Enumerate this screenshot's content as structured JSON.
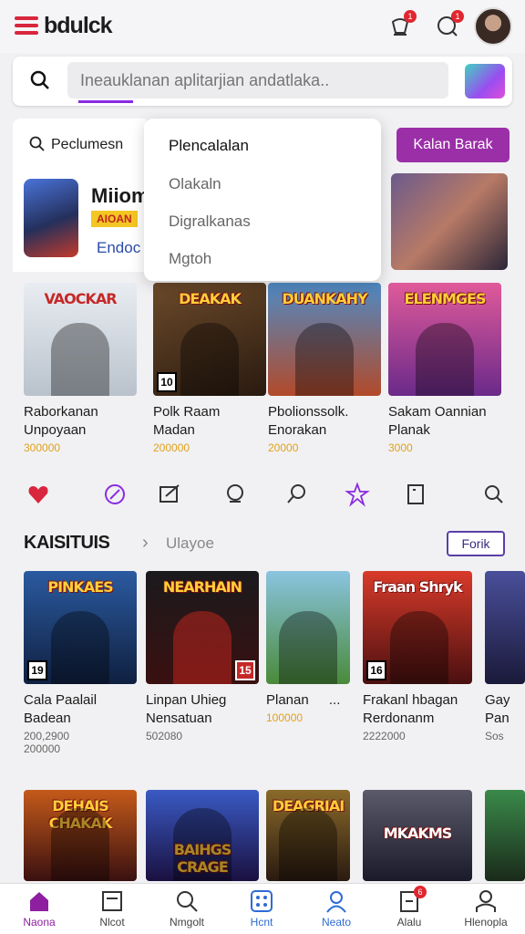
{
  "header": {
    "logo_main": "bdulck",
    "logo_accent": "",
    "notif_count_1": "1",
    "notif_count_2": "1"
  },
  "search": {
    "placeholder": "Ineauklanan aplitarjian andatlaka.."
  },
  "filter": {
    "label": "Peclumesn"
  },
  "dropdown": {
    "items": [
      "Plencalalan",
      "Olakaln",
      "Digralkanas",
      "Mgtoh"
    ]
  },
  "cta": {
    "label": "Kalan Barak"
  },
  "featured": {
    "title": "Miiom",
    "badge": "AIOAN",
    "subtitle": "Endoc"
  },
  "row1": [
    {
      "thumb_title": "VAOCKAR",
      "age": "",
      "name_1": "Raborkanan",
      "name_2": "Unpoyaan",
      "meta": "300000",
      "extra": "...",
      "color": "#c9cfd8"
    },
    {
      "thumb_title": "DEAKAK",
      "age": "10",
      "name_1": "Polk Raam",
      "name_2": "Madan",
      "meta": "200000",
      "extra": "",
      "color": "#4a3826"
    },
    {
      "thumb_title": "DUANKAHY",
      "age": "",
      "name_1": "Pbolionssolk.",
      "name_2": "Enorakan",
      "meta": "20000",
      "extra": "",
      "color": "#3a6aa0"
    },
    {
      "thumb_title": "ELENMGES",
      "age": "",
      "name_1": "Sakam Oannian",
      "name_2": "Planak",
      "meta": "3000",
      "extra": "",
      "color": "#d2496e"
    }
  ],
  "categories": [
    "heart-icon",
    "compass-icon",
    "edit-icon",
    "cloud-icon",
    "search-icon",
    "star-icon",
    "bookmark-icon",
    "search-icon"
  ],
  "section": {
    "title": "KAISITUIS",
    "subtitle": "Ulayoe",
    "button": "Forik"
  },
  "row2": [
    {
      "thumb_title": "PINKAES",
      "age": "19",
      "name_1": "Cala Paalail",
      "name_2": "Badean",
      "meta_1": "200,2900",
      "meta_2": "200000",
      "extra": "",
      "color": "#2a4a7a"
    },
    {
      "thumb_title": "NEARHAIN",
      "age": "15",
      "name_1": "Linpan Uhieg",
      "name_2": "Nensatuan",
      "meta_1": "502080",
      "meta_2": "",
      "extra": "",
      "color": "#1d1d20"
    },
    {
      "thumb_title": "",
      "age": "",
      "name_1": "Planan",
      "name_2": "",
      "meta_1": "100000",
      "meta_2": "",
      "extra": "...",
      "color": "#5aa05a"
    },
    {
      "thumb_title": "Fraan Shryk",
      "age": "16",
      "name_1": "Frakanl hbagan",
      "name_2": "Rerdonanm",
      "meta_1": "2222000",
      "meta_2": "",
      "extra": "",
      "color": "#b02a1e"
    },
    {
      "thumb_title": "",
      "age": "",
      "name_1": "Gay",
      "name_2": "Pan",
      "meta_1": "Sos",
      "meta_2": "",
      "extra": "",
      "color": "#3a3f7a"
    }
  ],
  "row3": [
    {
      "thumb_title": "DEHAIS CHAKAK",
      "color": "#8a3018"
    },
    {
      "thumb_title": "BAIHGS CRAGE",
      "color": "#2a3a8a"
    },
    {
      "thumb_title": "DEAGRIAI",
      "color": "#6a4a1a"
    },
    {
      "thumb_title": "MKAKMS",
      "color": "#3a3a4a"
    },
    {
      "thumb_title": "",
      "color": "#2a6a3a"
    }
  ],
  "nav": [
    {
      "label": "Naona",
      "icon": "home-icon"
    },
    {
      "label": "Nlcot",
      "icon": "news-icon"
    },
    {
      "label": "Nmgolt",
      "icon": "search-icon"
    },
    {
      "label": "Hcnt",
      "icon": "grid-icon"
    },
    {
      "label": "Neato",
      "icon": "user-icon"
    },
    {
      "label": "Alalu",
      "icon": "card-icon",
      "badge": "6"
    },
    {
      "label": "Hlenopla",
      "icon": "profile-icon"
    }
  ]
}
